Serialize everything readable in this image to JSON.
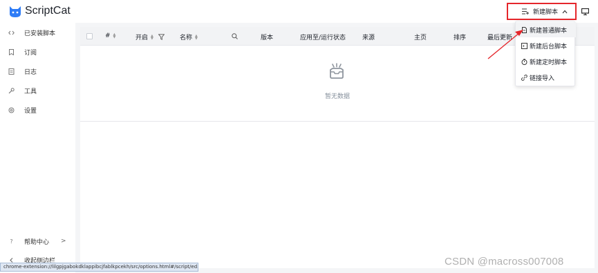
{
  "app": {
    "title": "ScriptCat",
    "brand_color": "#2e7cf6"
  },
  "header": {
    "new_script_label": "新建脚本",
    "new_script_icon": "list-add-icon",
    "chevron": "^",
    "highlight_color": "#e5262b",
    "display_icon": "monitor-icon"
  },
  "sidebar": {
    "items": [
      {
        "icon": "code-icon",
        "label": "已安装脚本"
      },
      {
        "icon": "bookmark-icon",
        "label": "订阅"
      },
      {
        "icon": "log-icon",
        "label": "日志"
      },
      {
        "icon": "tool-icon",
        "label": "工具"
      },
      {
        "icon": "gear-icon",
        "label": "设置"
      }
    ],
    "help": {
      "icon": "question-icon",
      "label": "帮助中心",
      "arrow": ">"
    },
    "collapse": {
      "icon": "chevron-left-icon",
      "label": "收起侧边栏"
    }
  },
  "table": {
    "columns": [
      "#",
      "开启",
      "名称",
      "版本",
      "应用至/运行状态",
      "来源",
      "主页",
      "排序",
      "最后更新"
    ],
    "empty_text": "暂无数据"
  },
  "dropdown": {
    "items": [
      {
        "icon": "file-icon",
        "label": "新建普通脚本"
      },
      {
        "icon": "terminal-icon",
        "label": "新建后台脚本"
      },
      {
        "icon": "timer-icon",
        "label": "新建定时脚本"
      },
      {
        "icon": "link-icon",
        "label": "链接导入"
      }
    ]
  },
  "status_url": "chrome-extension://lilgpjgabokdklappibcjfablkpcekh/src/options.html#/script/ed...",
  "watermark": "CSDN @macross007008"
}
